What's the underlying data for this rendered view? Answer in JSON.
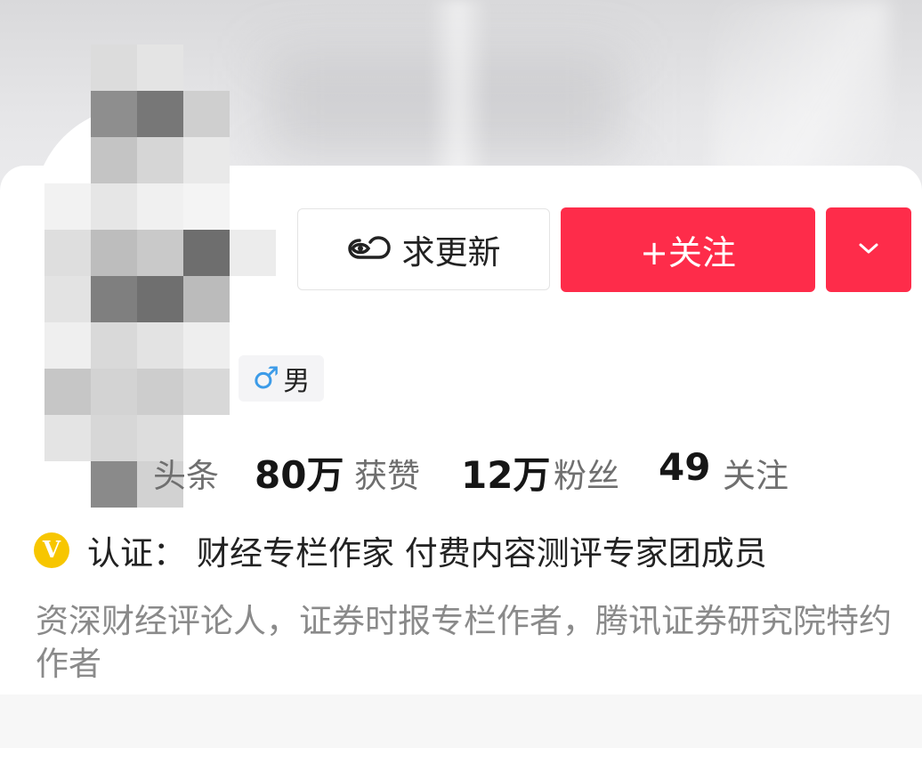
{
  "actions": {
    "update_request_label": "求更新",
    "follow_label": "+关注",
    "more_icon": "chevron-down-icon",
    "update_icon": "eye-cloud-icon"
  },
  "profile": {
    "gender_symbol": "♂",
    "gender_label": "男",
    "partial_stat_label": "头条"
  },
  "stats": [
    {
      "value": "80万",
      "label": "获赞"
    },
    {
      "value": "12万",
      "label": "粉丝"
    },
    {
      "value": "49",
      "label": "关注"
    }
  ],
  "verification": {
    "badge": "V",
    "prefix": "认证：",
    "text": "财经专栏作家 付费内容测评专家团成员"
  },
  "bio": "资深财经评论人，证券时报专栏作者，腾讯证券研究院特约作者",
  "colors": {
    "accent": "#fe2c4a",
    "badge": "#f7c600",
    "gender": "#3c9be8",
    "muted_text": "#8a8a8a"
  }
}
